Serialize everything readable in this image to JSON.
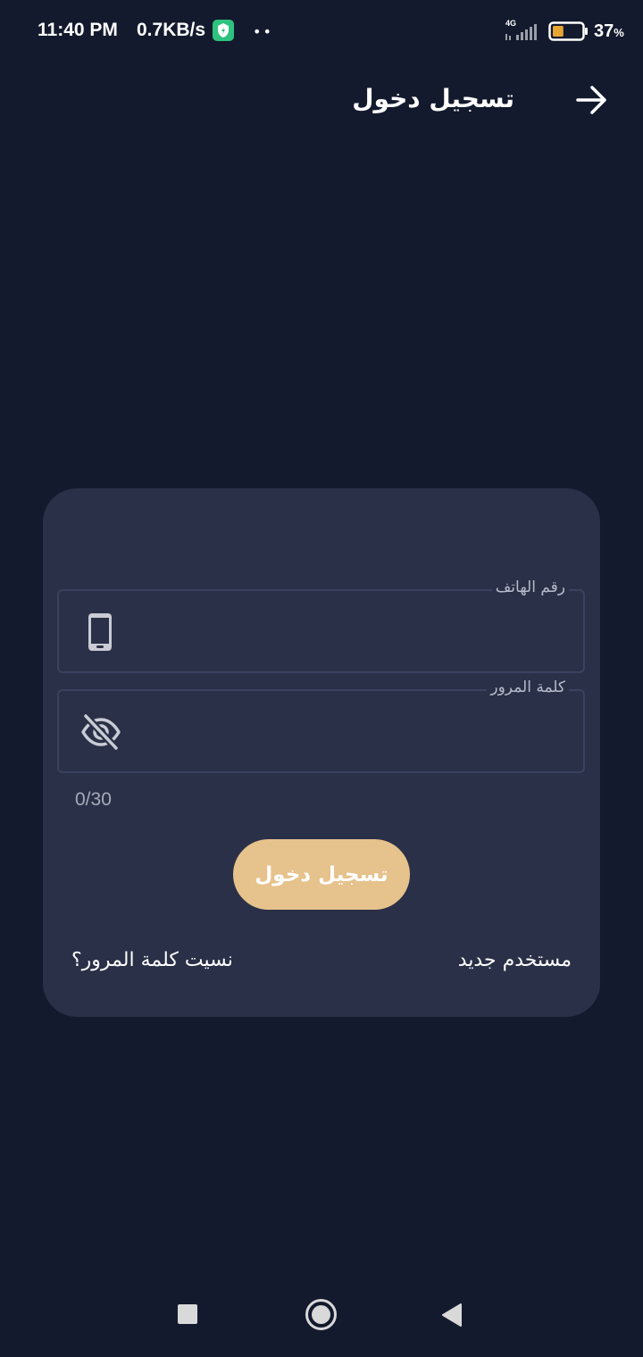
{
  "status_bar": {
    "time": "11:40 PM",
    "net_speed": "0.7KB/s",
    "dots": "••",
    "network": "4G",
    "battery_percent": "37",
    "battery_unit": "%",
    "battery_level": 0.37
  },
  "header": {
    "title": "تسجيل دخول",
    "back_icon": "arrow-right-icon"
  },
  "form": {
    "phone": {
      "label": "رقم الهاتف",
      "value": "",
      "icon": "smartphone-icon"
    },
    "password": {
      "label": "كلمة المرور",
      "value": "",
      "icon": "eye-off-icon",
      "counter": "0/30"
    },
    "submit_label": "تسجيل دخول",
    "new_user_label": "مستخدم جديد",
    "forgot_password_label": "نسيت كلمة المرور؟"
  },
  "colors": {
    "background": "#131a2d",
    "card": "#2a3047",
    "accent": "#e6c28c",
    "field_border": "#3a4260"
  },
  "nav_bar": {
    "recent_icon": "square-icon",
    "home_icon": "circle-icon",
    "back_icon": "triangle-back-icon"
  }
}
